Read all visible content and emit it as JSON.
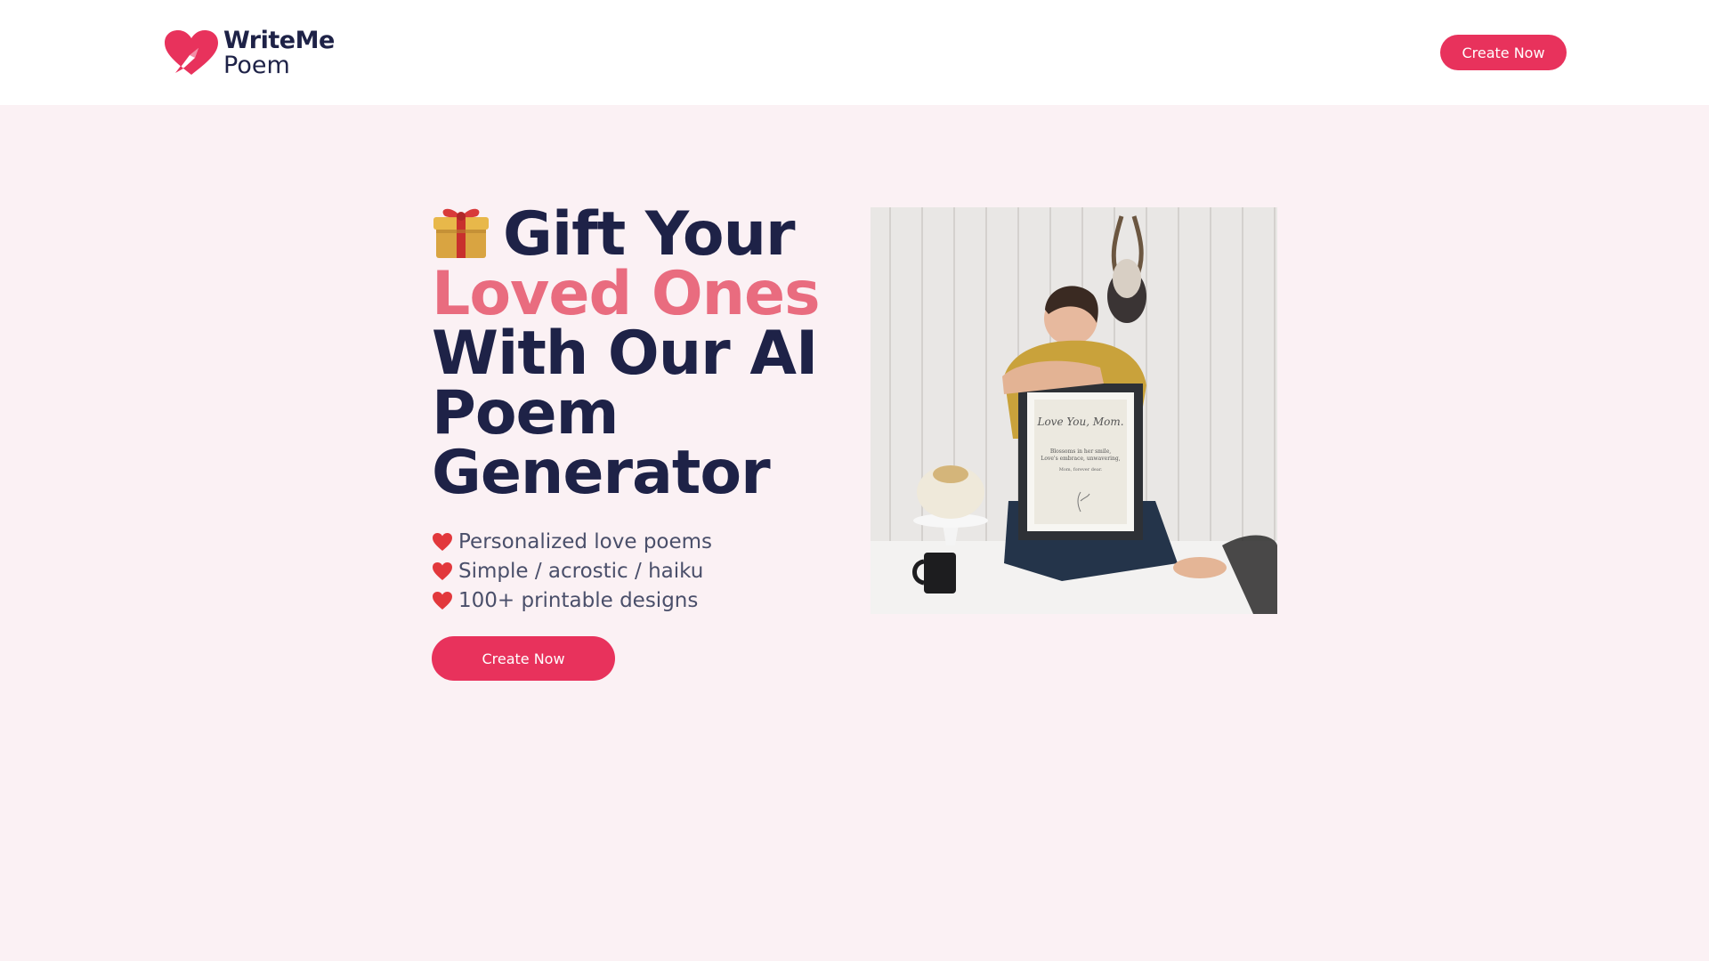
{
  "header": {
    "logo_line1": "WriteMe",
    "logo_line2": "Poem",
    "cta_label": "Create Now"
  },
  "hero": {
    "headline_line1": "Gift Your",
    "headline_line2": "Loved Ones",
    "headline_line3": "With Our AI",
    "headline_line4": "Poem",
    "headline_line5": "Generator",
    "features": [
      "Personalized love poems",
      "Simple / acrostic / haiku",
      "100+ printable designs"
    ],
    "cta_label": "Create Now",
    "frame_title": "Love You, Mom.",
    "frame_body_line1": "Blossoms in her smile,",
    "frame_body_line2": "Love's embrace, unwavering,",
    "frame_body_line3": "Mom, forever dear."
  },
  "colors": {
    "brand": "#e8325c",
    "accent_text": "#e96c7f",
    "heading": "#1e2247",
    "background": "#fbf1f4"
  },
  "icons": {
    "logo": "heart-pen-logo-icon",
    "gift": "gift-icon",
    "bullet": "red-heart-icon"
  }
}
